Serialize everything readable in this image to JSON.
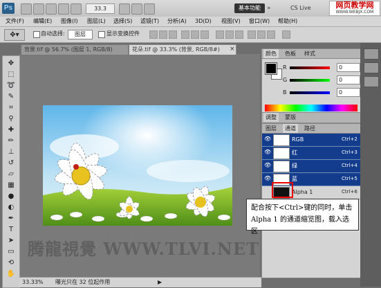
{
  "app": {
    "logo": "Ps",
    "zoom": "33.3",
    "workspace_button": "基本功能",
    "cs_live": "CS Live",
    "watermark_title": "网页教学网",
    "watermark_url": "WWW.WEBJX.COM"
  },
  "menu": [
    "文件(F)",
    "编辑(E)",
    "图像(I)",
    "图层(L)",
    "选择(S)",
    "滤镜(T)",
    "分析(A)",
    "3D(D)",
    "视图(V)",
    "窗口(W)",
    "帮助(H)"
  ],
  "options": {
    "auto_select_label": "自动选择:",
    "auto_select_value": "图层",
    "show_transform_label": "显示变换控件"
  },
  "tabs": {
    "inactive": "背景.tif @ 56.7% (图层 1, RGB/8)",
    "active": "花朵.tif @ 33.3% (背景, RGB/8#)",
    "close": "×"
  },
  "canvas": {
    "watermark": "腾龍視覺 WWW.TLVI.NET"
  },
  "status": {
    "zoom": "33.33%",
    "message": "曝光只在 32 位起作用",
    "arrow": "▶"
  },
  "color_panel": {
    "tabs": [
      "颜色",
      "色板",
      "样式"
    ],
    "r_label": "R",
    "r_value": "0",
    "g_label": "G",
    "g_value": "0",
    "b_label": "B",
    "b_value": "0"
  },
  "adjust_panel": {
    "tabs": [
      "调整",
      "蒙版"
    ]
  },
  "layers_panel": {
    "tabs": [
      "图层",
      "通道",
      "路径"
    ],
    "channels": [
      {
        "name": "RGB",
        "shortcut": "Ctrl+2"
      },
      {
        "name": "红",
        "shortcut": "Ctrl+3"
      },
      {
        "name": "绿",
        "shortcut": "Ctrl+4"
      },
      {
        "name": "蓝",
        "shortcut": "Ctrl+5"
      },
      {
        "name": "Alpha 1",
        "shortcut": "Ctrl+6"
      }
    ]
  },
  "callout": {
    "line1": "配合按下<Ctrl>键的同时，单击",
    "line2": "Alpha 1 的通道缩览图，载入选区"
  },
  "colors": {
    "selection": "#143c8c",
    "highlight": "#e00000"
  }
}
